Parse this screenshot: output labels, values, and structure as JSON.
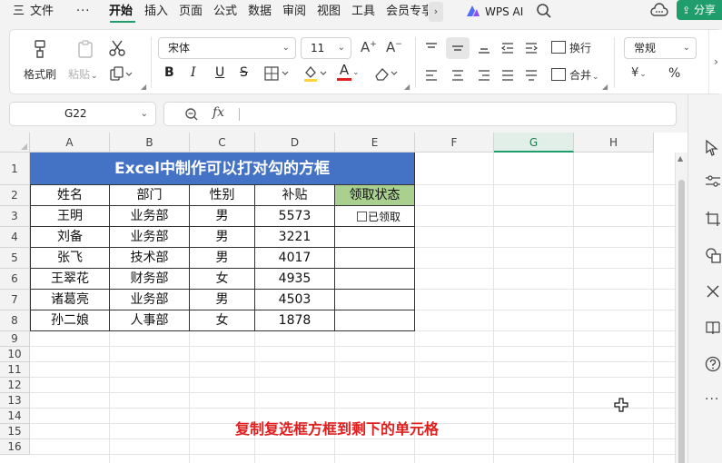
{
  "menubar": {
    "file_icon": "三",
    "file": "文件",
    "more": "···",
    "tabs": [
      "开始",
      "插入",
      "页面",
      "公式",
      "数据",
      "审阅",
      "视图",
      "工具",
      "会员专享"
    ],
    "active_tab": "开始",
    "scroll_right": "›",
    "wps_ai": "WPS AI",
    "share": "分享"
  },
  "ribbon": {
    "format_painter": "格式刷",
    "paste": "粘贴",
    "font_name": "宋体",
    "font_size": "11",
    "bold": "B",
    "italic": "I",
    "underline": "U",
    "strikethrough": "S",
    "font_color_glyph": "A",
    "wrap_text": "换行",
    "merge": "合并",
    "number_format": "常规",
    "currency": "¥",
    "percent": "%",
    "scroll_right": "›",
    "colors": {
      "fill_color": "#ffd43b",
      "font_color": "#e02020"
    }
  },
  "formula_bar": {
    "cell_ref": "G22",
    "fx_label": "fx",
    "content": ""
  },
  "sheet": {
    "columns": [
      "A",
      "B",
      "C",
      "D",
      "E",
      "F",
      "G",
      "H"
    ],
    "selected_column": "G",
    "rows": [
      "1",
      "2",
      "3",
      "4",
      "5",
      "6",
      "7",
      "8",
      "9",
      "10",
      "11",
      "12",
      "13",
      "14",
      "15",
      "16"
    ],
    "title": "Excel中制作可以打对勾的方框",
    "headers": [
      "姓名",
      "部门",
      "性别",
      "补贴",
      "领取状态"
    ],
    "records": [
      [
        "王明",
        "业务部",
        "男",
        "5573"
      ],
      [
        "刘备",
        "业务部",
        "男",
        "3221"
      ],
      [
        "张飞",
        "技术部",
        "男",
        "4017"
      ],
      [
        "王翠花",
        "财务部",
        "女",
        "4935"
      ],
      [
        "诸葛亮",
        "业务部",
        "男",
        "4503"
      ],
      [
        "孙二娘",
        "人事部",
        "女",
        "1878"
      ]
    ],
    "checkbox_label": "已领取",
    "checkbox_checked": false,
    "caption": "复制复选框方框到剩下的单元格",
    "colors": {
      "title_bg": "#4472c4",
      "status_header_bg": "#a9d08e",
      "caption": "#e02020",
      "accent": "#1f9e6b"
    }
  },
  "sidepanel": {
    "icons": [
      "select-pointer-icon",
      "adjust-sliders-icon",
      "crop-icon",
      "shapes-icon",
      "tools-icon",
      "book-icon",
      "help-icon",
      "more-icon"
    ],
    "more": "···"
  }
}
